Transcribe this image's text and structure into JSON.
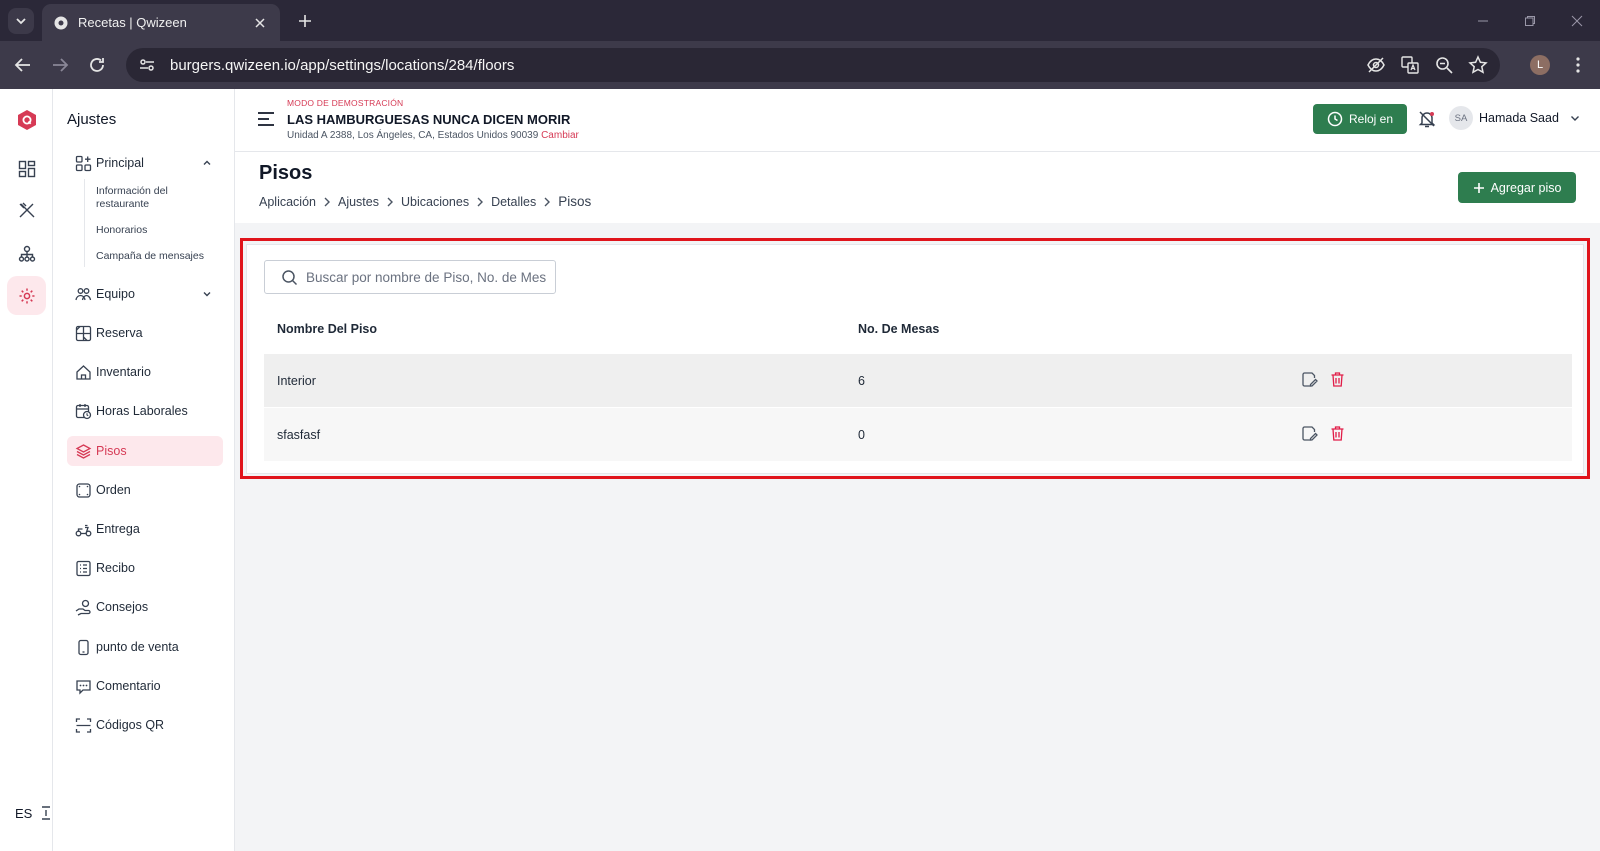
{
  "browser": {
    "tab_title": "Recetas | Qwizeen",
    "url": "burgers.qwizeen.io/app/settings/locations/284/floors",
    "profile_initial": "L"
  },
  "rail": {
    "language": "ES"
  },
  "sidebar": {
    "title": "Ajustes",
    "principal": "Principal",
    "sub_items": [
      "Información del restaurante",
      "Honorarios",
      "Campaña de mensajes"
    ],
    "items": [
      "Equipo",
      "Reserva",
      "Inventario",
      "Horas Laborales",
      "Pisos",
      "Orden",
      "Entrega",
      "Recibo",
      "Consejos",
      "punto de venta",
      "Comentario",
      "Códigos QR"
    ]
  },
  "header": {
    "demo_mode": "MODO DE DEMOSTRACIÓN",
    "restaurant": "LAS HAMBURGUESAS NUNCA DICEN MORIR",
    "address": "Unidad A 2388, Los Ángeles, CA, Estados Unidos 90039",
    "change": "Cambiar",
    "clock_label": "Reloj en",
    "user_initials": "SA",
    "user_name": "Hamada Saad"
  },
  "page": {
    "title": "Pisos",
    "breadcrumbs": [
      "Aplicación",
      "Ajustes",
      "Ubicaciones",
      "Detalles",
      "Pisos"
    ],
    "add_label": "Agregar piso"
  },
  "table": {
    "search_placeholder": "Buscar por nombre de Piso, No. de Mesas",
    "headers": [
      "Nombre Del Piso",
      "No. De Mesas"
    ],
    "rows": [
      {
        "name": "Interior",
        "tables": "6"
      },
      {
        "name": "sfasfasf",
        "tables": "0"
      }
    ]
  },
  "colors": {
    "accent": "#d63a55",
    "primary_button": "#2e7d4f",
    "highlight_border": "#e0141c"
  }
}
